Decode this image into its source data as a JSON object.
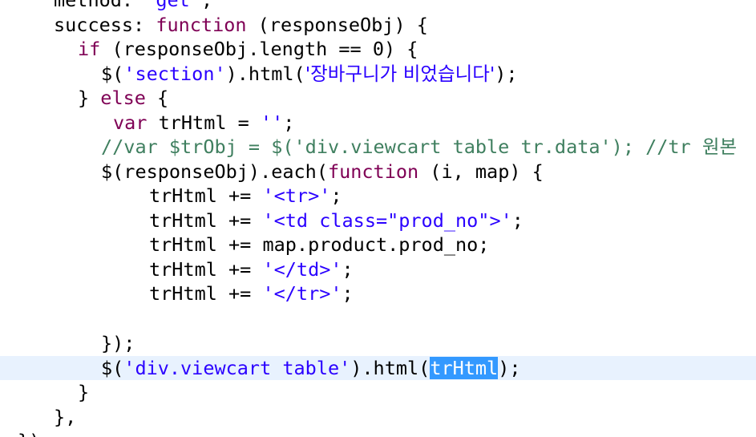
{
  "colors": {
    "keyword": "#7f0055",
    "string": "#2a00ff",
    "comment": "#3f7f5f",
    "default": "#000000",
    "current_line": "#e8f2fe",
    "selection": "#3399ff"
  },
  "lines": [
    {
      "t1": "method: ",
      "t2": "'get'",
      "t3": ","
    },
    {
      "t1": "success: ",
      "kw": "function",
      "t2": " (responseObj) {"
    },
    {
      "kw": "if",
      "t1": " (responseObj.length == 0) {"
    },
    {
      "t1": "$(",
      "s1": "'section'",
      "t2": ").html(",
      "s2": "'장바구니가 비었습니다'",
      "t3": ");"
    },
    {
      "t1": "} ",
      "kw": "else",
      "t2": " {"
    },
    {
      "kw": "var",
      "t1": " trHtml = ",
      "s1": "''",
      "t2": ";"
    },
    {
      "c": "//var $trObj = $('div.viewcart table tr.data'); //tr 원본"
    },
    {
      "t1": "$(responseObj).each(",
      "kw": "function",
      "t2": " (i, map) {"
    },
    {
      "t1": "trHtml += ",
      "s1": "'<tr>'",
      "t2": ";"
    },
    {
      "t1": "trHtml += ",
      "s1": "'<td class=\"prod_no\">'",
      "t2": ";"
    },
    {
      "t1": "trHtml += map.product.prod_no;"
    },
    {
      "t1": "trHtml += ",
      "s1": "'</td>'",
      "t2": ";"
    },
    {
      "t1": "trHtml += ",
      "s1": "'</tr>'",
      "t2": ";"
    },
    {
      "t1": "});"
    },
    {
      "t1": "$(",
      "s1": "'div.viewcart table'",
      "t2": ").html(",
      "sel": "trHtml",
      "t3": ");"
    },
    {
      "t1": "}"
    },
    {
      "t1": "},"
    },
    {
      "t1": "});"
    }
  ]
}
